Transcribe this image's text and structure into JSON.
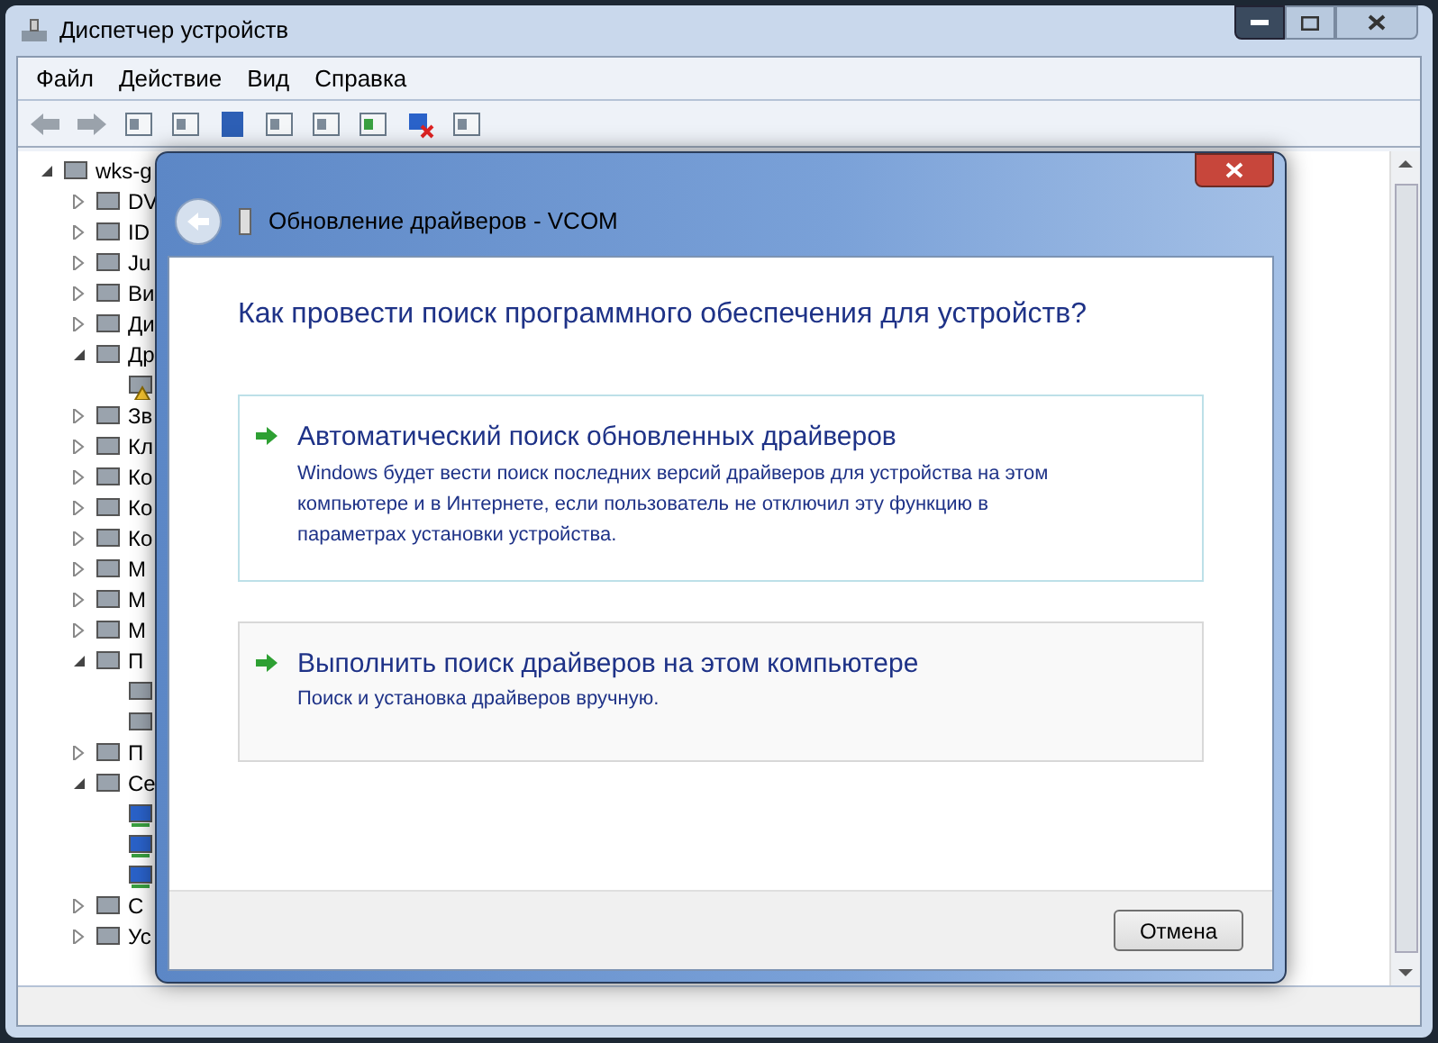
{
  "window": {
    "title": "Диспетчер устройств"
  },
  "menu": [
    "Файл",
    "Действие",
    "Вид",
    "Справка"
  ],
  "tree": {
    "label": "wks-g",
    "expanded": true,
    "children": [
      {
        "label": "DV",
        "expanded": false
      },
      {
        "label": "ID",
        "expanded": false
      },
      {
        "label": "Ju",
        "expanded": false
      },
      {
        "label": "Ви",
        "expanded": false
      },
      {
        "label": "Ди",
        "expanded": false
      },
      {
        "label": "Др",
        "expanded": true,
        "children": [
          {
            "kind": "warning"
          }
        ]
      },
      {
        "label": "Зв",
        "expanded": false
      },
      {
        "label": "Кл",
        "expanded": false
      },
      {
        "label": "Ко",
        "expanded": false
      },
      {
        "label": "Ко",
        "expanded": false
      },
      {
        "label": "Ко",
        "expanded": false
      },
      {
        "label": "М",
        "expanded": false
      },
      {
        "label": "М",
        "expanded": false
      },
      {
        "label": "М",
        "expanded": false
      },
      {
        "label": "П",
        "expanded": true,
        "children": [
          {
            "kind": "device"
          },
          {
            "kind": "device"
          }
        ]
      },
      {
        "label": "П",
        "expanded": false
      },
      {
        "label": "Се",
        "expanded": true,
        "children": [
          {
            "kind": "network"
          },
          {
            "kind": "network"
          },
          {
            "kind": "network"
          }
        ]
      },
      {
        "label": "С",
        "expanded": false
      },
      {
        "label": "Ус",
        "expanded": false
      }
    ]
  },
  "dialog": {
    "title": "Обновление драйверов - VCOM",
    "heading": "Как провести поиск программного обеспечения для устройств?",
    "options": [
      {
        "title": "Автоматический поиск обновленных драйверов",
        "description": "Windows будет вести поиск последних версий драйверов для устройства на этом компьютере и в Интернете, если пользователь не отключил эту функцию в параметрах установки устройства.",
        "selected": true
      },
      {
        "title": "Выполнить поиск драйверов на этом компьютере",
        "description": "Поиск и установка драйверов вручную.",
        "selected": false
      }
    ],
    "cancel": "Отмена"
  }
}
